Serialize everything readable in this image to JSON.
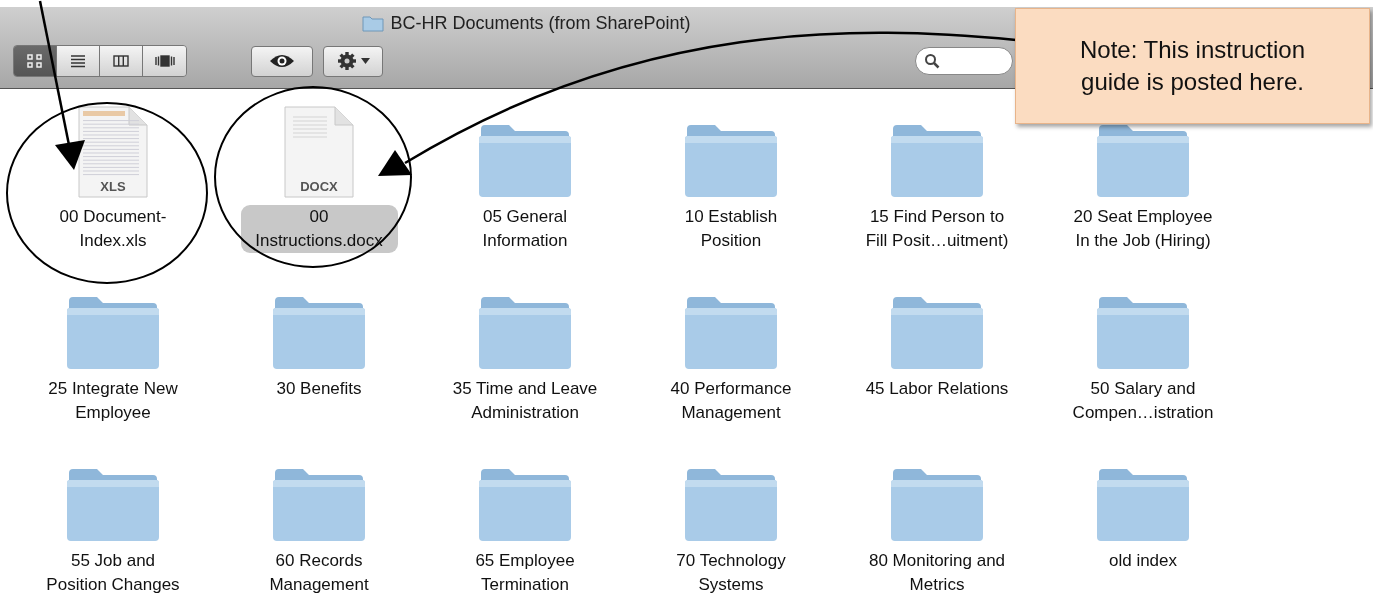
{
  "window": {
    "title": "BC-HR Documents (from SharePoint)"
  },
  "view_buttons": [
    {
      "kind": "icons",
      "selected": true
    },
    {
      "kind": "list",
      "selected": false
    },
    {
      "kind": "columns",
      "selected": false
    },
    {
      "kind": "coverflow",
      "selected": false
    }
  ],
  "items": [
    {
      "kind": "file",
      "badge": "XLS",
      "name": "00 Document-Index.xls",
      "selected": false
    },
    {
      "kind": "file",
      "badge": "DOCX",
      "name": "00 Instructions.docx",
      "selected": true
    },
    {
      "kind": "folder",
      "name": "05 General Information",
      "selected": false
    },
    {
      "kind": "folder",
      "name": "10 Establish Position",
      "selected": false
    },
    {
      "kind": "folder",
      "name": "15 Find Person to Fill Posit…uitment)",
      "selected": false
    },
    {
      "kind": "folder",
      "name": "20 Seat Employee In the Job (Hiring)",
      "selected": false
    },
    {
      "kind": "folder",
      "name": "25 Integrate New Employee",
      "selected": false
    },
    {
      "kind": "folder",
      "name": "30 Benefits",
      "selected": false
    },
    {
      "kind": "folder",
      "name": "35 Time and Leave Administration",
      "selected": false
    },
    {
      "kind": "folder",
      "name": "40 Performance Management",
      "selected": false
    },
    {
      "kind": "folder",
      "name": "45 Labor Relations",
      "selected": false
    },
    {
      "kind": "folder",
      "name": "50 Salary and Compen…istration",
      "selected": false
    },
    {
      "kind": "folder",
      "name": "55 Job and Position Changes",
      "selected": false
    },
    {
      "kind": "folder",
      "name": "60 Records Management",
      "selected": false
    },
    {
      "kind": "folder",
      "name": "65 Employee Termination",
      "selected": false
    },
    {
      "kind": "folder",
      "name": "70 Technology Systems",
      "selected": false
    },
    {
      "kind": "folder",
      "name": "80 Monitoring and Metrics",
      "selected": false
    },
    {
      "kind": "folder",
      "name": "old index",
      "selected": false
    }
  ],
  "note": "Note: This instruction guide is posted here."
}
